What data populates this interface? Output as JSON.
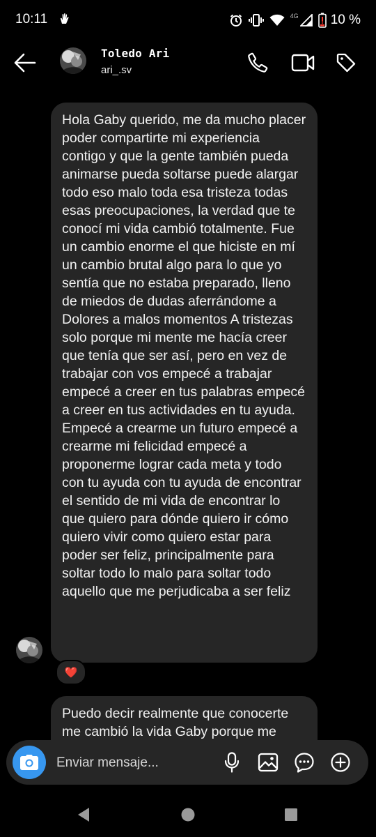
{
  "status_bar": {
    "time": "10:11",
    "network": "4G",
    "battery": "10 %",
    "icons": [
      "hand-notification-icon",
      "alarm-icon",
      "vibrate-icon",
      "wifi-icon",
      "signal-icon",
      "battery-low-icon"
    ]
  },
  "header": {
    "contact_name": "Toledo Ari",
    "username": "ari_.sv",
    "icons": [
      "back-arrow-icon",
      "phone-icon",
      "video-camera-icon",
      "tag-icon"
    ]
  },
  "messages": [
    {
      "from": "contact",
      "text": "Hola Gaby querido, me da mucho placer poder compartirte mi experiencia contigo y que la gente también pueda animarse pueda soltarse puede alargar todo eso malo toda esa tristeza todas esas preocupaciones, la verdad que te conocí mi vida cambió totalmente. Fue un cambio enorme el que hiciste en mí un cambio brutal algo para lo que yo sentía que no estaba preparado, lleno de miedos de dudas aferrándome a Dolores a malos momentos A tristezas solo porque mi mente me hacía creer que tenía que ser así, pero en vez de trabajar con vos empecé a trabajar empecé a creer en tus palabras empecé a creer en tus actividades en tu ayuda. Empecé a crearme un futuro empecé a crearme mi felicidad empecé a proponerme lograr cada meta y todo con tu ayuda con tu ayuda de encontrar el sentido de mi vida de encontrar lo que quiero para dónde quiero ir cómo quiero vivir como quiero estar para poder ser feliz, principalmente para soltar todo lo malo para soltar todo aquello que me perjudicaba a ser feliz",
      "reaction": "❤️"
    },
    {
      "from": "contact",
      "text": "Puedo decir realmente que conocerte me cambió la vida Gaby porque me"
    }
  ],
  "composer": {
    "placeholder": "Enviar mensaje...",
    "value": "",
    "icons": [
      "camera-icon",
      "microphone-icon",
      "image-icon",
      "sticker-icon",
      "add-icon"
    ]
  },
  "colors": {
    "background": "#000000",
    "bubble": "#262626",
    "camera_button": "#3797f0",
    "battery_low": "#ff3b30"
  }
}
